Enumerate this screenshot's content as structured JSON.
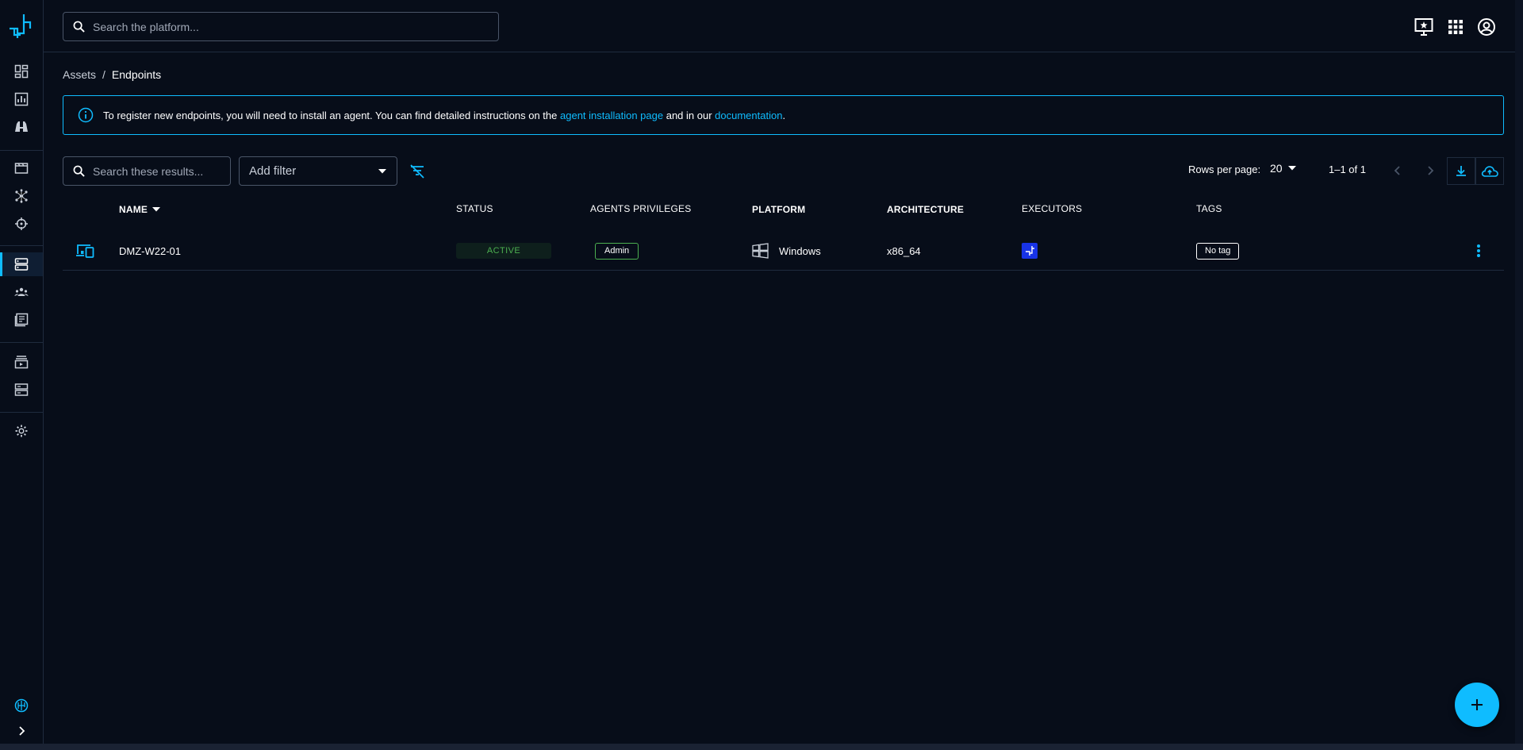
{
  "colors": {
    "background": "#070d19",
    "accent": "#0fbcff",
    "status_active": "#4caf50",
    "executor_blue": "#1833e6"
  },
  "sidebar": {
    "logo": "filigran-logo-icon",
    "items": [
      {
        "icon": "dashboard-icon"
      },
      {
        "icon": "analytics-icon"
      },
      {
        "icon": "binoculars-icon"
      },
      {
        "icon": "scenarios-icon"
      },
      {
        "icon": "network-icon"
      },
      {
        "icon": "crosshair-icon"
      },
      {
        "icon": "endpoints-icon",
        "active": true
      },
      {
        "icon": "teams-icon"
      },
      {
        "icon": "news-icon"
      },
      {
        "icon": "injectors-icon"
      },
      {
        "icon": "servers-icon"
      },
      {
        "icon": "gear-icon"
      }
    ],
    "footer_icons": [
      "globe-icon",
      "chevron-right-icon"
    ]
  },
  "topbar": {
    "search_placeholder": "Search the platform...",
    "icons": [
      "monitor-star-icon",
      "apps-grid-icon",
      "account-icon"
    ]
  },
  "breadcrumb": {
    "parent": "Assets",
    "separator": "/",
    "current": "Endpoints"
  },
  "alert": {
    "text_before": "To register new endpoints, you will need to install an agent. You can find detailed instructions on the ",
    "link1": "agent installation page",
    "text_middle": " and in our ",
    "link2": "documentation",
    "text_after": "."
  },
  "filters": {
    "search_placeholder": "Search these results...",
    "add_filter_label": "Add filter"
  },
  "pagination": {
    "rows_per_page_label": "Rows per page:",
    "rows_per_page_value": "20",
    "range": "1–1 of 1"
  },
  "table": {
    "headers": {
      "name": "NAME",
      "status": "STATUS",
      "privileges": "AGENTS PRIVILEGES",
      "platform": "PLATFORM",
      "architecture": "ARCHITECTURE",
      "executors": "EXECUTORS",
      "tags": "TAGS"
    },
    "rows": [
      {
        "icon": "endpoint-devices-icon",
        "name": "DMZ-W22-01",
        "status": "ACTIVE",
        "privilege": "Admin",
        "platform_icon": "windows-icon",
        "platform": "Windows",
        "architecture": "x86_64",
        "executor_icon": "openbas-executor-icon",
        "tag": "No tag"
      }
    ]
  },
  "fab": {
    "icon": "plus-icon"
  }
}
